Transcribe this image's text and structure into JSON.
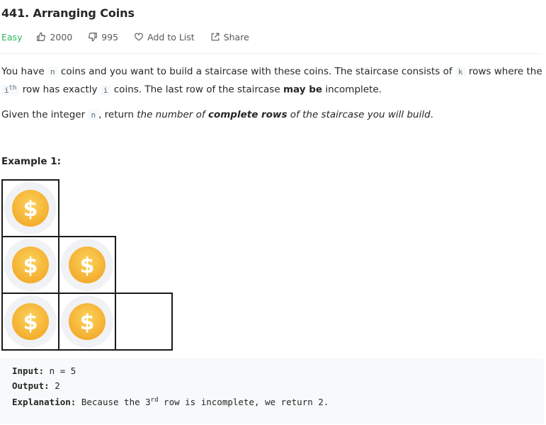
{
  "problem": {
    "title": "441. Arranging Coins",
    "difficulty": "Easy",
    "likes": "2000",
    "dislikes": "995",
    "add_to_list": "Add to List",
    "share": "Share"
  },
  "description": {
    "p1_a": "You have ",
    "p1_code_n": "n",
    "p1_b": " coins and you want to build a staircase with these coins. The staircase consists of ",
    "p1_code_k": "k",
    "p1_c": " rows where the ",
    "p1_code_i": "i",
    "p1_sup": "th",
    "p1_d": " row has exactly ",
    "p1_code_i2": "i",
    "p1_e": " coins. The last row of the staircase ",
    "p1_bold": "may be",
    "p1_f": " incomplete.",
    "p2_a": "Given the integer ",
    "p2_code_n": "n",
    "p2_b": ", return ",
    "p2_italic1": "the number of ",
    "p2_bolditalic": "complete rows",
    "p2_italic2": " of the staircase you will build",
    "p2_end": "."
  },
  "example": {
    "title": "Example 1:",
    "input_label": "Input:",
    "input_value": " n = 5",
    "output_label": "Output:",
    "output_value": " 2",
    "explanation_label": "Explanation:",
    "explanation_a": " Because the 3",
    "explanation_sup": "rd",
    "explanation_b": " row is incomplete, we return 2.",
    "coin_symbol": "$"
  }
}
